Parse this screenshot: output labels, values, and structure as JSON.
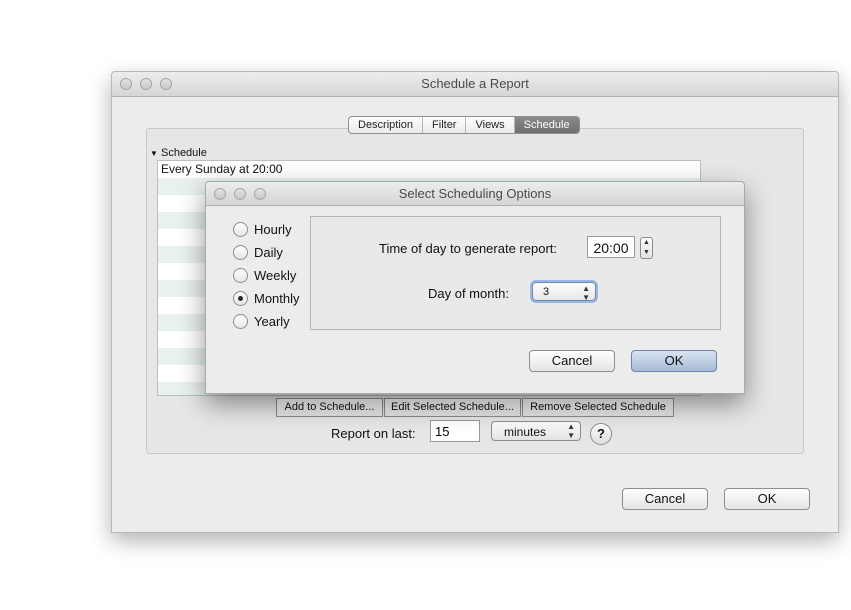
{
  "main_window": {
    "title": "Schedule a Report",
    "tabs": [
      {
        "label": "Description"
      },
      {
        "label": "Filter"
      },
      {
        "label": "Views"
      },
      {
        "label": "Schedule",
        "selected": true
      }
    ],
    "schedule_section": {
      "header": "Schedule",
      "disclosure_icon": "triangle-down-icon",
      "items": [
        "Every Sunday at 20:00"
      ]
    },
    "buttons": {
      "add": "Add to Schedule...",
      "edit": "Edit Selected Schedule...",
      "remove": "Remove Selected Schedule"
    },
    "report_on_last": {
      "label": "Report on last:",
      "value": "15",
      "units": "minutes",
      "help": "?"
    },
    "footer": {
      "cancel": "Cancel",
      "ok": "OK"
    }
  },
  "dialog": {
    "title": "Select Scheduling Options",
    "frequency_options": [
      {
        "label": "Hourly",
        "selected": false
      },
      {
        "label": "Daily",
        "selected": false
      },
      {
        "label": "Weekly",
        "selected": false
      },
      {
        "label": "Monthly",
        "selected": true
      },
      {
        "label": "Yearly",
        "selected": false
      }
    ],
    "time_label": "Time of day to generate report:",
    "time_value": "20:00",
    "day_label": "Day of month:",
    "day_value": "3",
    "cancel": "Cancel",
    "ok": "OK"
  },
  "colors": {
    "window_bg": "#ececec",
    "selected_tab": "#7a7a7a",
    "list_alt_row": "#e8f0f0",
    "default_button": "#a8bbd6",
    "focus_ring": "#9ab7e6"
  }
}
